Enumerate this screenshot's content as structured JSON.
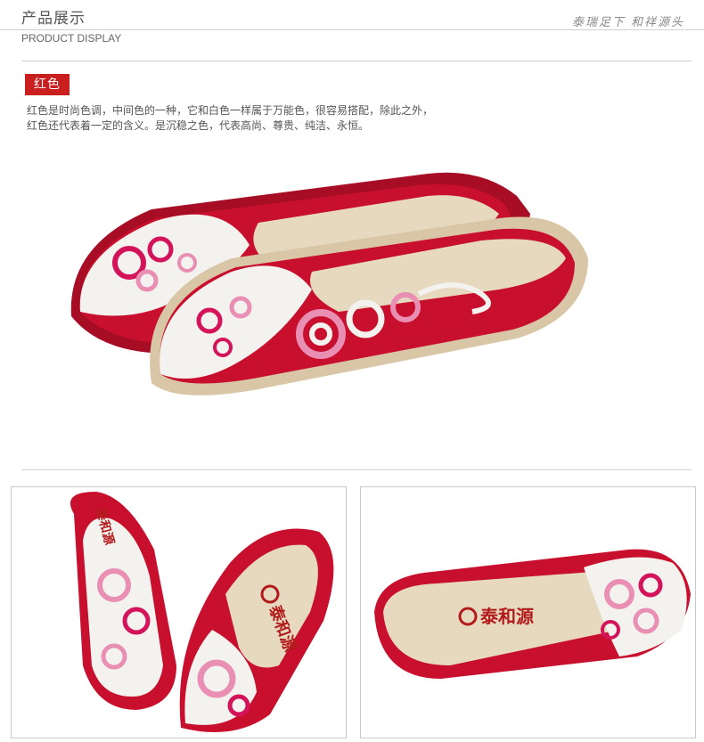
{
  "header": {
    "title_cn": "产品展示",
    "title_en": "PRODUCT DISPLAY",
    "slogan": "泰瑞足下 和祥源头"
  },
  "color_section": {
    "badge": "红色",
    "description_line1": "红色是时尚色调，中间色的一种，它和白色一样属于万能色，很容易搭配，除此之外，",
    "description_line2": "红色还代表着一定的含义。是沉稳之色，代表高尚、尊贵、纯洁、永恒。"
  },
  "product": {
    "brand_logo_text": "泰和源",
    "colors": {
      "shoe_red": "#c8102e",
      "trim_dark": "#a80d26",
      "toe_white": "#f4f2ee",
      "embroidery_pink": "#e88fb3",
      "embroidery_magenta": "#d4145a",
      "insole_linen": "#e6d9c0",
      "sole_tan": "#d8c6a6"
    }
  }
}
